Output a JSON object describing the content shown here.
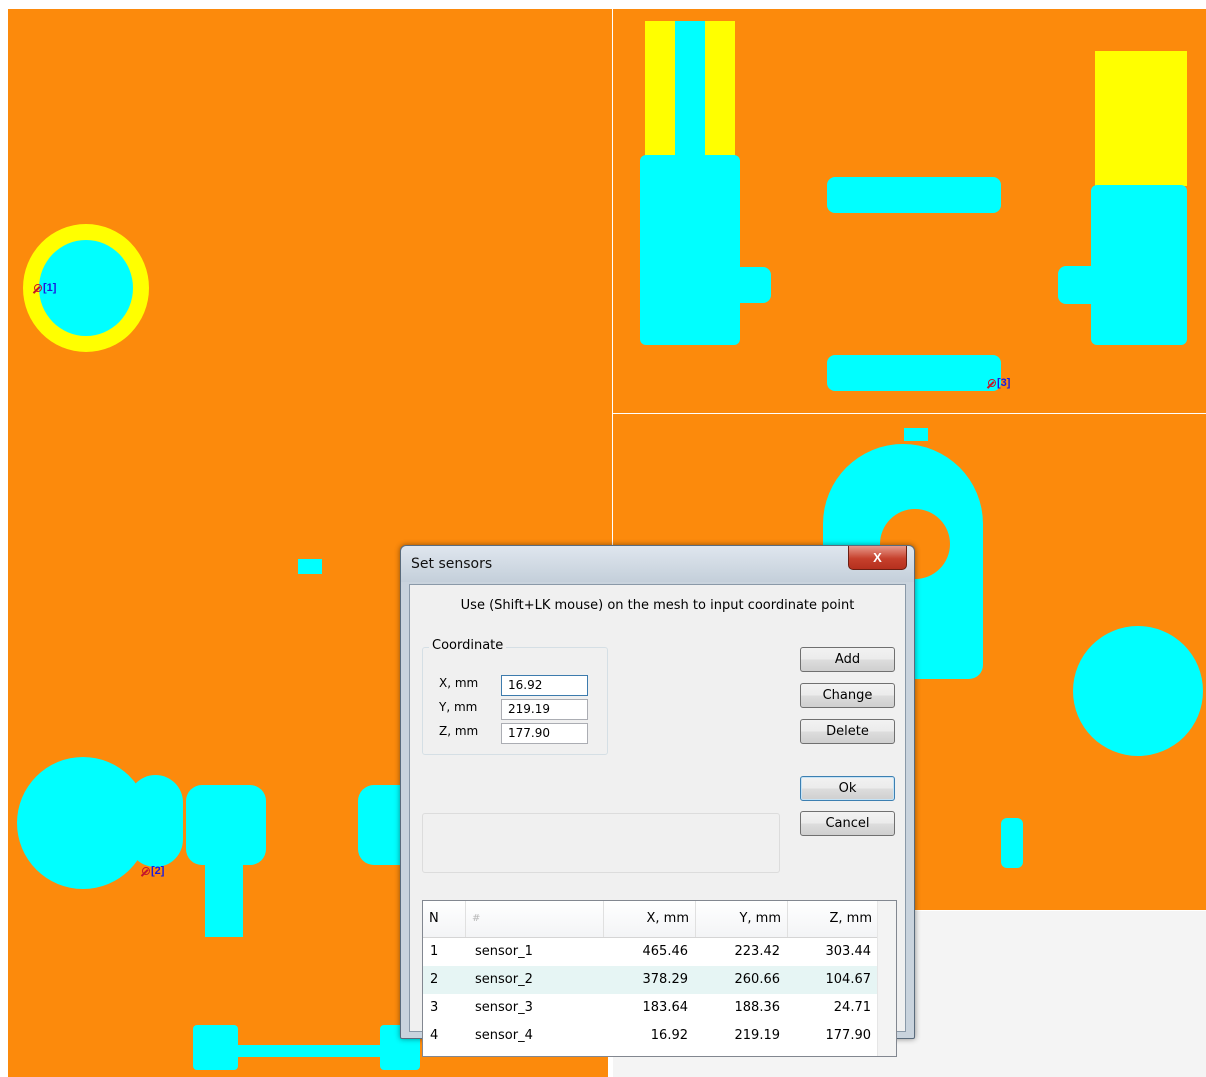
{
  "sensors": [
    "[1]",
    "[2]",
    "[3]"
  ],
  "dialog": {
    "title": "Set sensors",
    "close_glyph": "X",
    "instruction": "Use (Shift+LK mouse) on the mesh to input coordinate point",
    "coordinate_group": "Coordinate",
    "fields": {
      "x": {
        "label": "X, mm",
        "value": "16.92"
      },
      "y": {
        "label": "Y, mm",
        "value": "219.19"
      },
      "z": {
        "label": "Z, mm",
        "value": "177.90"
      }
    },
    "buttons": {
      "add": "Add",
      "change": "Change",
      "delete": "Delete",
      "ok": "Ok",
      "cancel": "Cancel"
    },
    "table": {
      "headers": [
        "N",
        "#",
        "X, mm",
        "Y, mm",
        "Z, mm"
      ],
      "rows": [
        [
          "1",
          "sensor_1",
          "465.46",
          "223.42",
          "303.44"
        ],
        [
          "2",
          "sensor_2",
          "378.29",
          "260.66",
          "104.67"
        ],
        [
          "3",
          "sensor_3",
          "183.64",
          "188.36",
          "24.71"
        ],
        [
          "4",
          "sensor_4",
          "16.92",
          "219.19",
          "177.90"
        ]
      ]
    }
  },
  "colors": {
    "background_mesh": "#fc8a0c",
    "part": "#00ffff",
    "highlight": "#ffff00",
    "sensor_marker": "#c4162b",
    "sensor_label": "#1a1ae0"
  }
}
